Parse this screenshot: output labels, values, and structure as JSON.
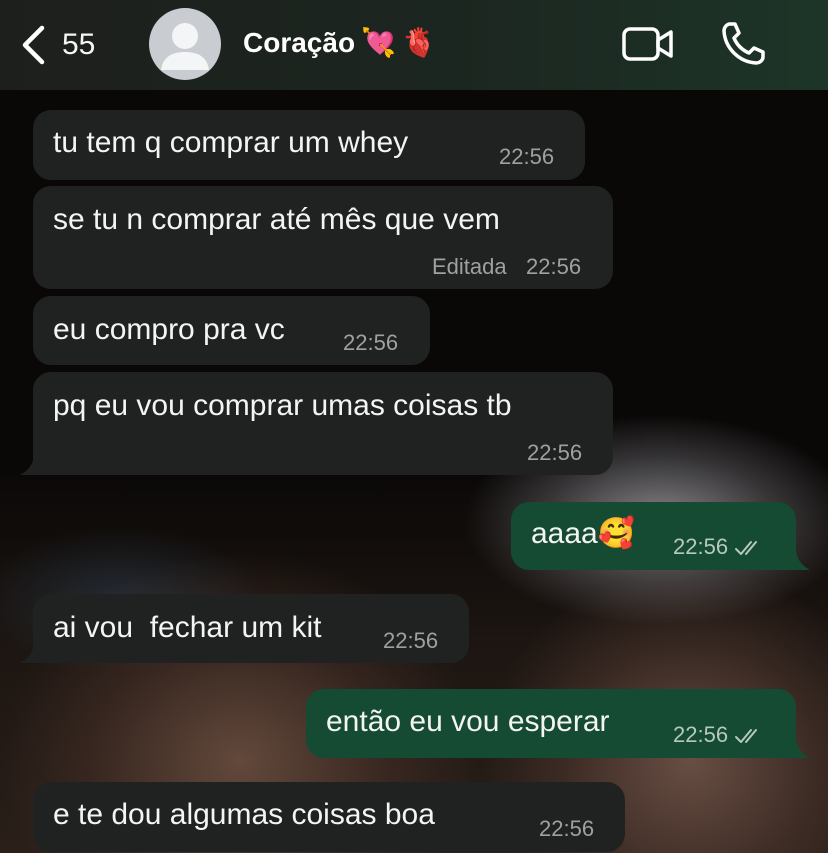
{
  "header": {
    "back_count": "55",
    "contact_name": "Coração",
    "name_emojis": [
      "💘",
      "🫀"
    ]
  },
  "icons": {
    "back": "chevron-left-icon",
    "avatar": "default-avatar-icon",
    "video": "video-camera-icon",
    "call": "phone-icon",
    "read": "double-check-icon"
  },
  "colors": {
    "header_bg": "#1c2620",
    "incoming_bubble": "#202222",
    "outgoing_bubble": "#154b32",
    "text": "#f4f4f4",
    "time": "#9ea1a1"
  },
  "messages": [
    {
      "direction": "in",
      "text": "tu tem q comprar um whey",
      "time": "22:56",
      "edited": ""
    },
    {
      "direction": "in",
      "text": "se tu n comprar até mês que vem",
      "time": "22:56",
      "edited": "Editada"
    },
    {
      "direction": "in",
      "text": "eu compro pra vc",
      "time": "22:56",
      "edited": ""
    },
    {
      "direction": "in",
      "text": "pq eu vou comprar umas coisas tb",
      "time": "22:56",
      "edited": ""
    },
    {
      "direction": "out",
      "text": "aaaa🥰",
      "time": "22:56",
      "edited": ""
    },
    {
      "direction": "in",
      "text": "ai vou  fechar um kit",
      "time": "22:56",
      "edited": ""
    },
    {
      "direction": "out",
      "text": "então eu vou esperar",
      "time": "22:56",
      "edited": ""
    },
    {
      "direction": "in",
      "text": "e te dou algumas coisas boa",
      "time": "22:56",
      "edited": ""
    }
  ]
}
